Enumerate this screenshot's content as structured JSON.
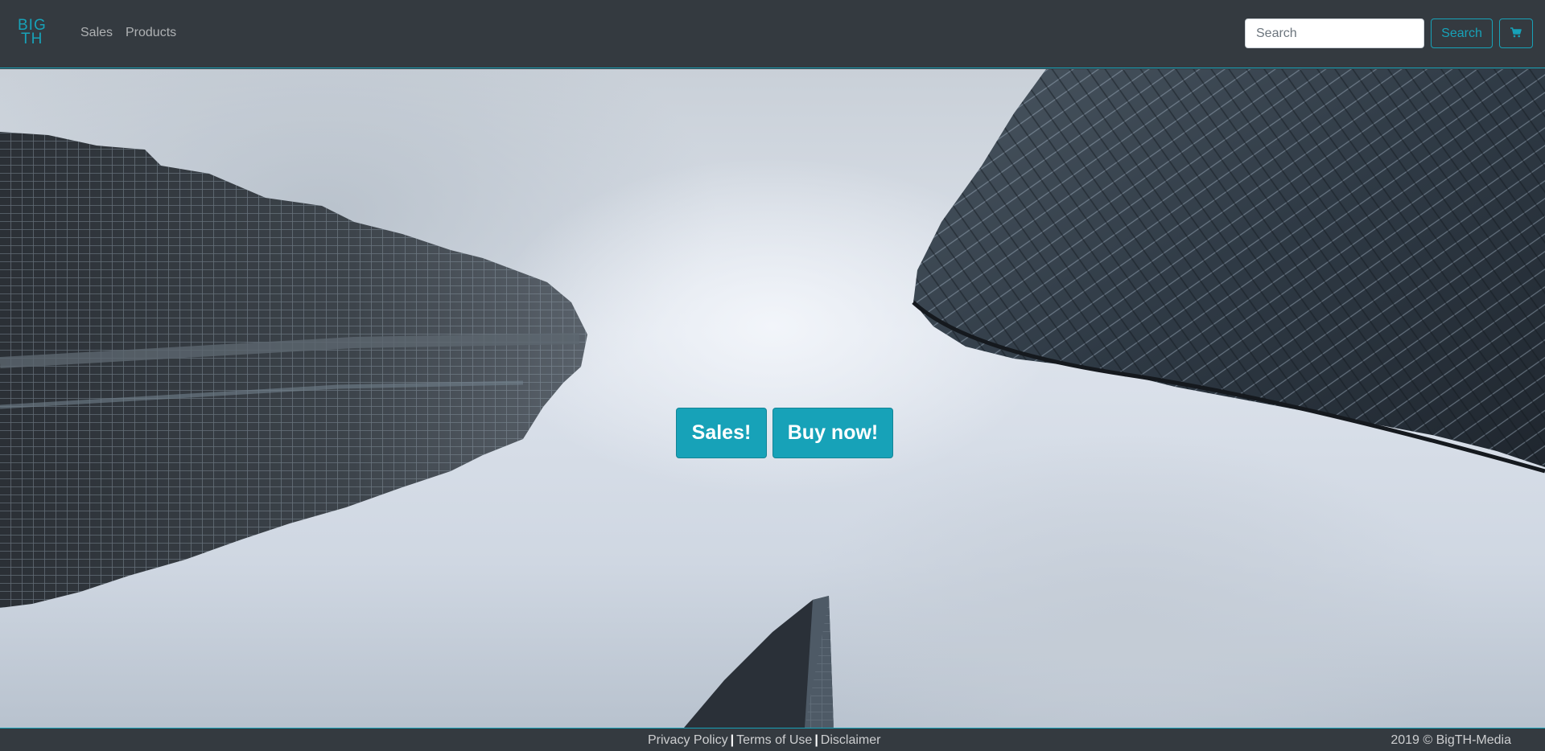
{
  "header": {
    "logo_line1": "BIG",
    "logo_line2": "TH",
    "nav": {
      "sales": "Sales",
      "products": "Products"
    },
    "search": {
      "placeholder": "Search",
      "button_label": "Search"
    },
    "cart_icon": "shopping-cart-icon"
  },
  "hero": {
    "buttons": {
      "sales": "Sales!",
      "buy": "Buy now!"
    }
  },
  "footer": {
    "links": {
      "privacy": "Privacy Policy",
      "terms": "Terms of Use",
      "disclaimer": "Disclaimer"
    },
    "separator": "|",
    "copyright": "2019 © BigTH-Media"
  },
  "colors": {
    "accent": "#17a2b8",
    "navbar": "#343a40"
  }
}
